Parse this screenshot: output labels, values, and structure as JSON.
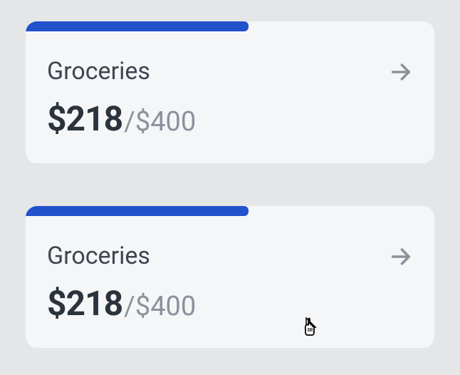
{
  "cards": [
    {
      "name": "Groceries",
      "spent": "$218",
      "total": "/$400",
      "progress_percent": 54.5
    },
    {
      "name": "Groceries",
      "spent": "$218",
      "total": "/$400",
      "progress_percent": 54.5
    }
  ],
  "colors": {
    "accent": "#2251cc",
    "card_bg": "#f5f6f7",
    "page_bg": "#e5e6e8"
  }
}
